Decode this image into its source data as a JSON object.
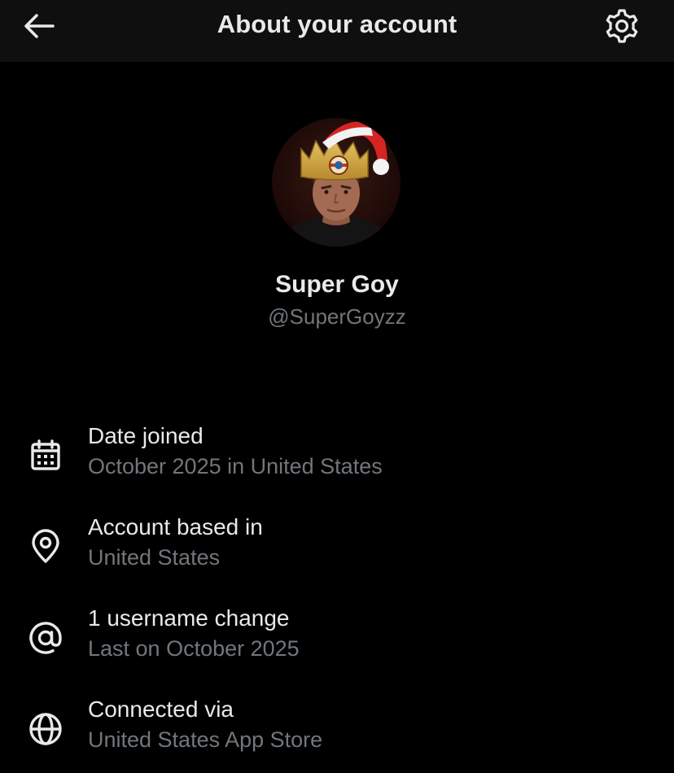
{
  "header": {
    "back_icon": "arrow-left-icon",
    "title": "About your account",
    "settings_icon": "gear-icon"
  },
  "profile": {
    "display_name": "Super Goy",
    "handle": "@SuperGoyzz"
  },
  "info": [
    {
      "icon": "calendar-icon",
      "label": "Date joined",
      "value": "October 2025 in United States"
    },
    {
      "icon": "location-pin-icon",
      "label": "Account based in",
      "value": "United States"
    },
    {
      "icon": "at-sign-icon",
      "label": "1 username change",
      "value": "Last on October 2025"
    },
    {
      "icon": "globe-icon",
      "label": "Connected via",
      "value": "United States App Store"
    }
  ],
  "colors": {
    "background": "#000000",
    "header_background": "#0f0f0f",
    "primary_text": "#e7e9ea",
    "secondary_text": "#71767b"
  }
}
